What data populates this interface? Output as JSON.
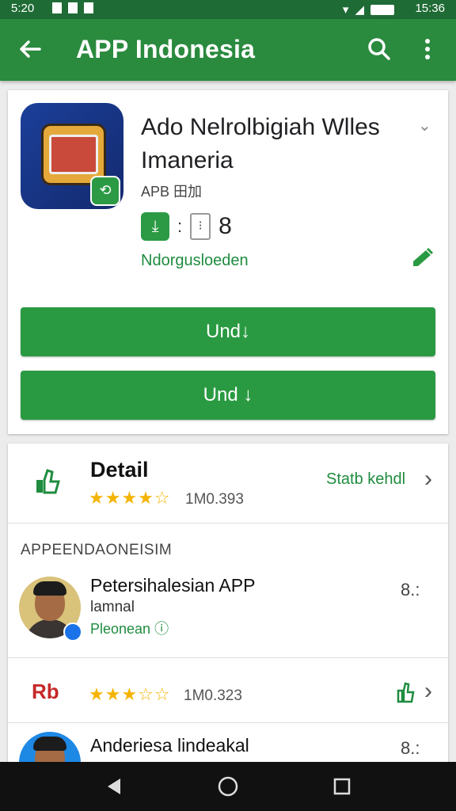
{
  "status_bar": {
    "time": "5:20",
    "clock": "15:36"
  },
  "app_bar": {
    "title": "APP Indonesia"
  },
  "app": {
    "title": "Ado Nelrolbigiah Wlles Imaneria",
    "subtitle": "APB 田加",
    "install_count": "8",
    "status_link": "Ndorgusloeden",
    "button1_label": "Und↓",
    "button2_label": "Und ↓"
  },
  "detail": {
    "title": "Detail",
    "stars": "★★★★☆",
    "count": "1M0.393",
    "link": "Statb kehdl"
  },
  "section": {
    "label": "APPEENDAONEISIM"
  },
  "reviews": [
    {
      "name": "Petersihalesian APP",
      "subtitle": "lamnal",
      "link": "Pleonean ⓘ",
      "number": "8.:"
    },
    {
      "name": "Anderiesa lindeakal",
      "number": "8.:"
    }
  ],
  "rb_row": {
    "logo": "Rb",
    "stars": "★★★☆☆",
    "count": "1M0.323"
  },
  "colors": {
    "primary": "#2a8a3e",
    "status_bar": "#1f6b35",
    "button": "#2a9a42",
    "link": "#1f8c3f",
    "star": "#f4b400"
  }
}
